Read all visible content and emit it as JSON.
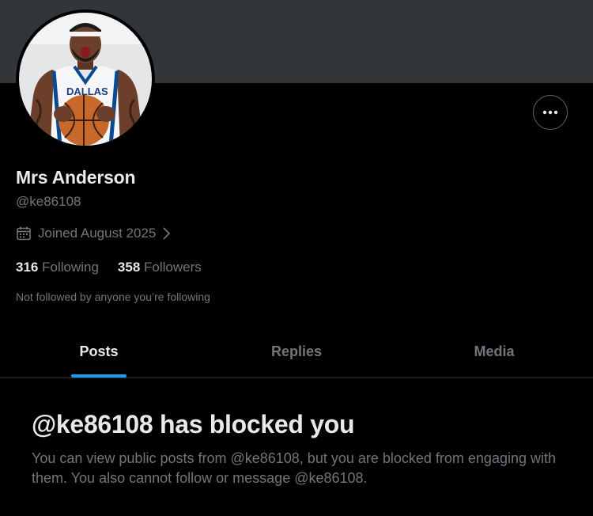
{
  "profile": {
    "display_name": "Mrs Anderson",
    "handle": "@ke86108",
    "joined": "Joined August 2025",
    "following_count": "316",
    "following_label": "Following",
    "followers_count": "358",
    "followers_label": "Followers",
    "not_followed_note": "Not followed by anyone you’re following",
    "avatar_jersey_text": "DALLAS",
    "avatar_icon": "basketball-player-photo"
  },
  "tabs": [
    {
      "label": "Posts",
      "active": true
    },
    {
      "label": "Replies",
      "active": false
    },
    {
      "label": "Media",
      "active": false
    }
  ],
  "blocked": {
    "title": "@ke86108 has blocked you",
    "body": "You can view public posts from @ke86108, but you are blocked from engaging with them. You also cannot follow or message @ke86108."
  },
  "colors": {
    "background": "#000000",
    "banner": "#333639",
    "primary_text": "#e7e9ea",
    "secondary_text": "#71767b",
    "accent": "#1d9bf0",
    "divider": "#2f3336"
  },
  "icons": {
    "more": "more-horizontal-icon",
    "calendar": "calendar-icon",
    "chevron": "chevron-right-icon"
  }
}
